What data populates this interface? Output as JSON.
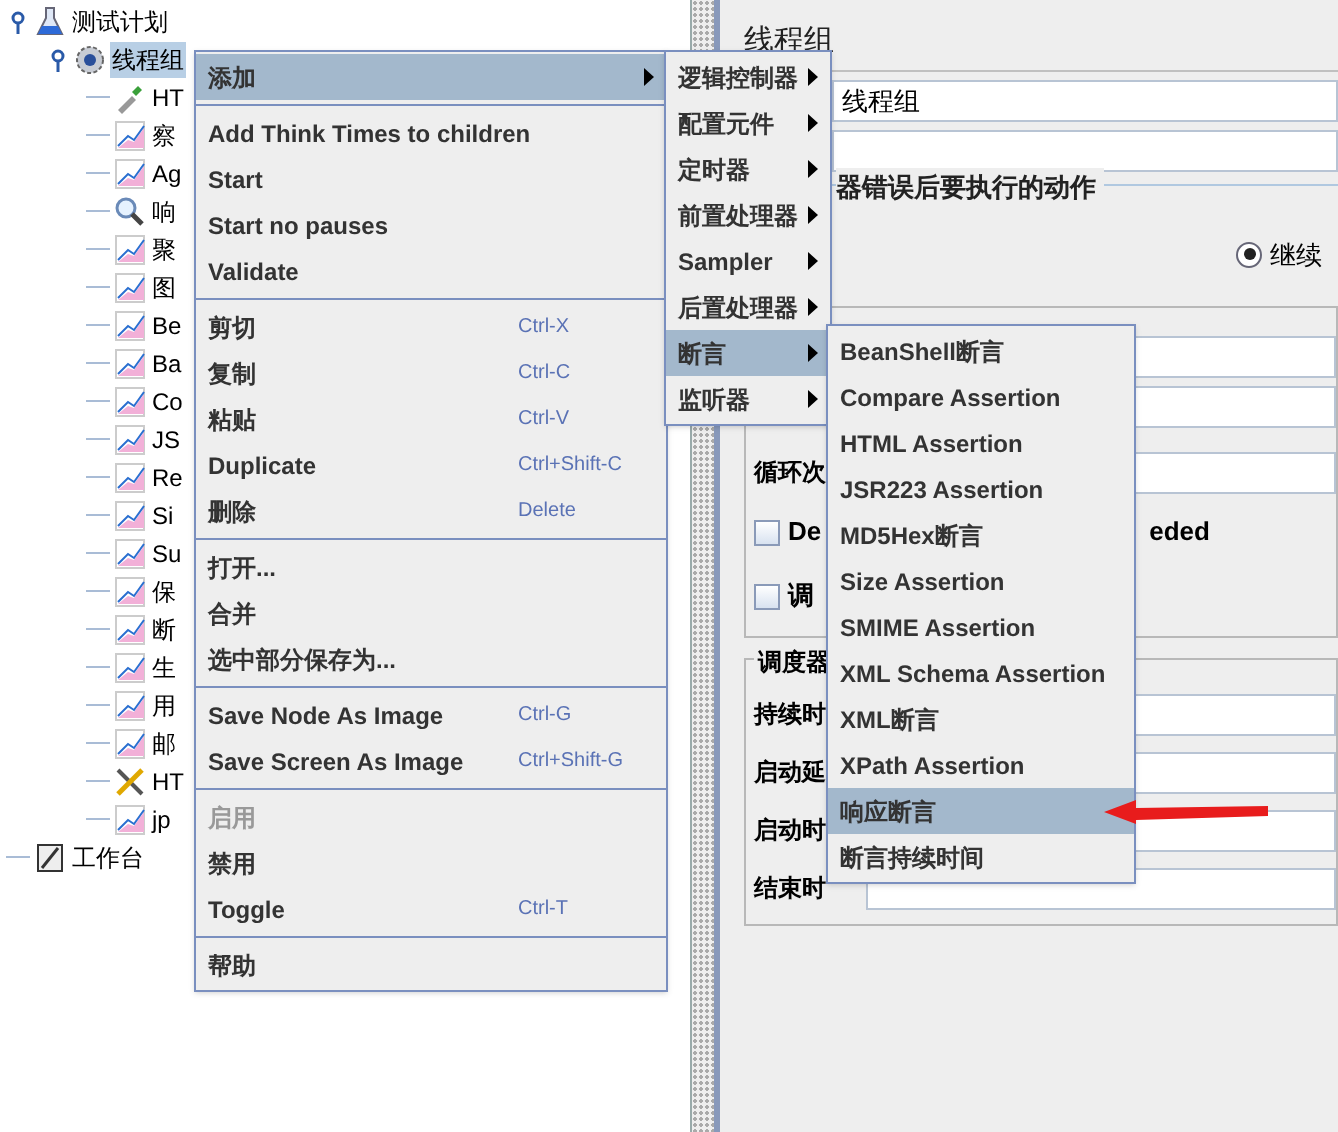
{
  "tree": {
    "items": [
      {
        "label": "测试计划",
        "kind": "flask",
        "selected": false,
        "expanded": true,
        "children": [
          {
            "label": "线程组",
            "kind": "gear",
            "selected": true,
            "expanded": true,
            "children": [
              {
                "label": "HT",
                "kind": "pipette",
                "selected": false
              },
              {
                "label": "察",
                "kind": "graph",
                "selected": false
              },
              {
                "label": "Ag",
                "kind": "graph",
                "selected": false
              },
              {
                "label": "响",
                "kind": "magnifier",
                "selected": false
              },
              {
                "label": "聚",
                "kind": "graph",
                "selected": false
              },
              {
                "label": "图",
                "kind": "graph",
                "selected": false
              },
              {
                "label": "Be",
                "kind": "graph",
                "selected": false
              },
              {
                "label": "Ba",
                "kind": "graph",
                "selected": false
              },
              {
                "label": "Co",
                "kind": "graph",
                "selected": false
              },
              {
                "label": "JS",
                "kind": "graph",
                "selected": false
              },
              {
                "label": "Re",
                "kind": "graph",
                "selected": false
              },
              {
                "label": "Si",
                "kind": "graph",
                "selected": false
              },
              {
                "label": "Su",
                "kind": "graph",
                "selected": false
              },
              {
                "label": "保",
                "kind": "graph",
                "selected": false
              },
              {
                "label": "断",
                "kind": "graph",
                "selected": false
              },
              {
                "label": "生",
                "kind": "graph",
                "selected": false
              },
              {
                "label": "用",
                "kind": "graph",
                "selected": false
              },
              {
                "label": "邮",
                "kind": "graph",
                "selected": false
              },
              {
                "label": "HT",
                "kind": "tools",
                "selected": false
              },
              {
                "label": "jp",
                "kind": "graph",
                "selected": false
              }
            ]
          }
        ]
      },
      {
        "label": "工作台",
        "kind": "notebook",
        "selected": false
      }
    ]
  },
  "context_menu": {
    "items": [
      {
        "kind": "submenu",
        "label": "添加",
        "selected": true,
        "disabled": false
      },
      {
        "kind": "separator"
      },
      {
        "kind": "item",
        "label": "Add Think Times to children",
        "selected": false,
        "disabled": false
      },
      {
        "kind": "item",
        "label": "Start",
        "selected": false,
        "disabled": false
      },
      {
        "kind": "item",
        "label": "Start no pauses",
        "selected": false,
        "disabled": false
      },
      {
        "kind": "item",
        "label": "Validate",
        "selected": false,
        "disabled": false
      },
      {
        "kind": "separator"
      },
      {
        "kind": "item",
        "label": "剪切",
        "shortcut": "Ctrl-X",
        "selected": false,
        "disabled": false
      },
      {
        "kind": "item",
        "label": "复制",
        "shortcut": "Ctrl-C",
        "selected": false,
        "disabled": false
      },
      {
        "kind": "item",
        "label": "粘贴",
        "shortcut": "Ctrl-V",
        "selected": false,
        "disabled": false
      },
      {
        "kind": "item",
        "label": "Duplicate",
        "shortcut": "Ctrl+Shift-C",
        "selected": false,
        "disabled": false
      },
      {
        "kind": "item",
        "label": "删除",
        "shortcut": "Delete",
        "selected": false,
        "disabled": false
      },
      {
        "kind": "separator"
      },
      {
        "kind": "item",
        "label": "打开...",
        "selected": false,
        "disabled": false
      },
      {
        "kind": "item",
        "label": "合并",
        "selected": false,
        "disabled": false
      },
      {
        "kind": "item",
        "label": "选中部分保存为...",
        "selected": false,
        "disabled": false
      },
      {
        "kind": "separator"
      },
      {
        "kind": "item",
        "label": "Save Node As Image",
        "shortcut": "Ctrl-G",
        "selected": false,
        "disabled": false
      },
      {
        "kind": "item",
        "label": "Save Screen As Image",
        "shortcut": "Ctrl+Shift-G",
        "selected": false,
        "disabled": false
      },
      {
        "kind": "separator"
      },
      {
        "kind": "item",
        "label": "启用",
        "selected": false,
        "disabled": true
      },
      {
        "kind": "item",
        "label": "禁用",
        "selected": false,
        "disabled": false
      },
      {
        "kind": "item",
        "label": "Toggle",
        "shortcut": "Ctrl-T",
        "selected": false,
        "disabled": false
      },
      {
        "kind": "separator"
      },
      {
        "kind": "item",
        "label": "帮助",
        "selected": false,
        "disabled": false
      }
    ]
  },
  "add_submenu": {
    "items": [
      {
        "label": "逻辑控制器",
        "selected": false
      },
      {
        "label": "配置元件",
        "selected": false
      },
      {
        "label": "定时器",
        "selected": false
      },
      {
        "label": "前置处理器",
        "selected": false
      },
      {
        "label": "Sampler",
        "selected": false
      },
      {
        "label": "后置处理器",
        "selected": false
      },
      {
        "label": "断言",
        "selected": true
      },
      {
        "label": "监听器",
        "selected": false
      }
    ]
  },
  "assertion_submenu": {
    "items": [
      {
        "label": "BeanShell断言",
        "selected": false
      },
      {
        "label": "Compare Assertion",
        "selected": false
      },
      {
        "label": "HTML Assertion",
        "selected": false
      },
      {
        "label": "JSR223 Assertion",
        "selected": false
      },
      {
        "label": "MD5Hex断言",
        "selected": false
      },
      {
        "label": "Size Assertion",
        "selected": false
      },
      {
        "label": "SMIME Assertion",
        "selected": false
      },
      {
        "label": "XML Schema Assertion",
        "selected": false
      },
      {
        "label": "XML断言",
        "selected": false
      },
      {
        "label": "XPath Assertion",
        "selected": false
      },
      {
        "label": "响应断言",
        "selected": true
      },
      {
        "label": "断言持续时间",
        "selected": false
      }
    ]
  },
  "panel": {
    "title": "线程组",
    "name_value": "线程组",
    "error_action": {
      "label": "器错误后要执行的动作",
      "options": [
        {
          "label": "继续",
          "selected": true
        }
      ]
    },
    "loop_label": "循环次",
    "checkboxes": [
      {
        "label": "De",
        "label_end": "eded",
        "checked": false
      },
      {
        "label": "调",
        "checked": false
      }
    ],
    "scheduler": {
      "title": "调度器",
      "fields": [
        "持续时",
        "启动延",
        "启动时",
        "结束时"
      ]
    }
  }
}
